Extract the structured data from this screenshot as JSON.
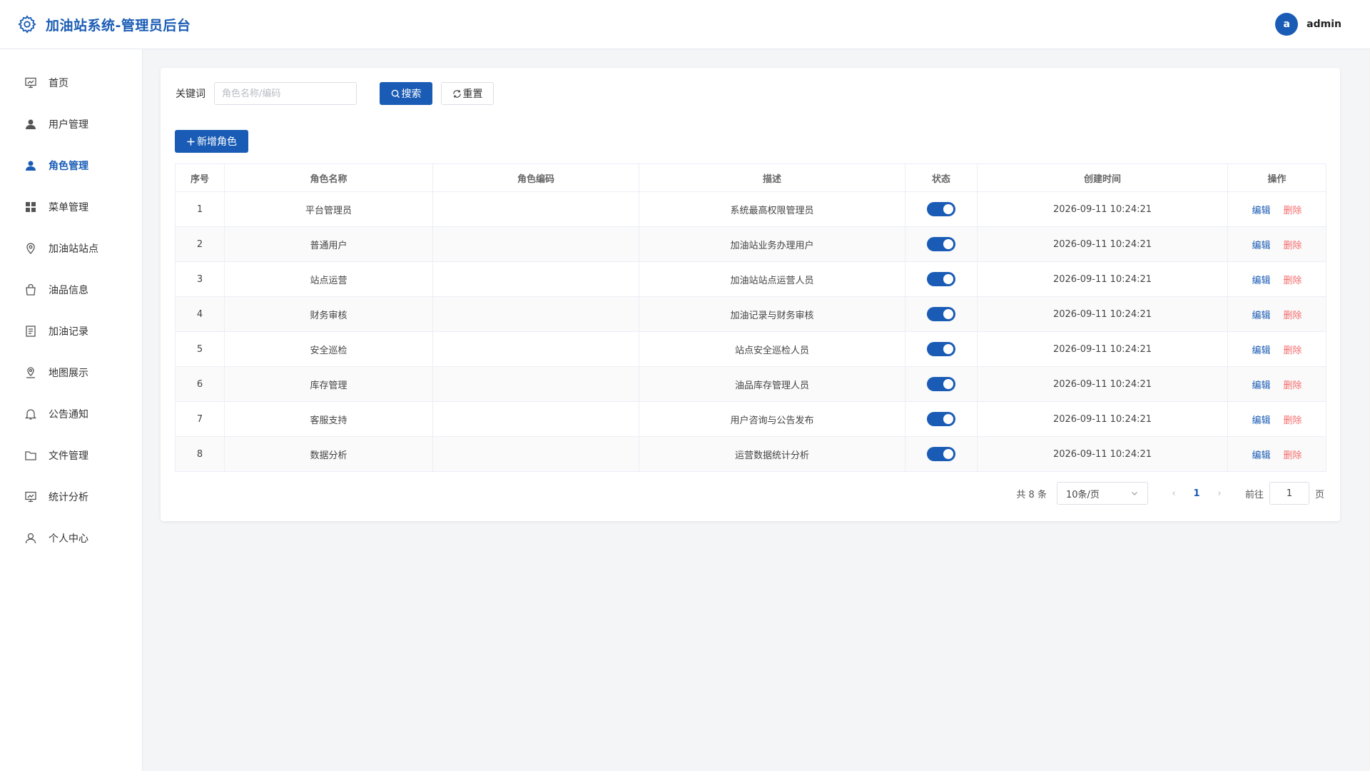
{
  "header": {
    "title": "加油站系统-管理员后台",
    "avatar_letter": "a",
    "username": "admin",
    "brand_color": "#1a5cb5"
  },
  "sidebar": {
    "items": [
      {
        "label": "首页",
        "icon": "dashboard-icon",
        "active": false
      },
      {
        "label": "用户管理",
        "icon": "user-icon",
        "active": false
      },
      {
        "label": "角色管理",
        "icon": "user-icon",
        "active": true
      },
      {
        "label": "菜单管理",
        "icon": "grid-icon",
        "active": false
      },
      {
        "label": "加油站站点",
        "icon": "location-icon",
        "active": false
      },
      {
        "label": "油品信息",
        "icon": "bag-icon",
        "active": false
      },
      {
        "label": "加油记录",
        "icon": "document-icon",
        "active": false
      },
      {
        "label": "地图展示",
        "icon": "map-pin-icon",
        "active": false
      },
      {
        "label": "公告通知",
        "icon": "bell-icon",
        "active": false
      },
      {
        "label": "文件管理",
        "icon": "folder-icon",
        "active": false
      },
      {
        "label": "统计分析",
        "icon": "chart-board-icon",
        "active": false
      },
      {
        "label": "个人中心",
        "icon": "person-outline-icon",
        "active": false
      }
    ]
  },
  "search": {
    "label": "关键词",
    "placeholder": "角色名称/编码",
    "value": "",
    "search_label": "搜索",
    "reset_label": "重置"
  },
  "add_label": "新增角色",
  "table": {
    "columns": [
      "序号",
      "角色名称",
      "角色编码",
      "描述",
      "状态",
      "创建时间",
      "操作"
    ],
    "edit_label": "编辑",
    "delete_label": "删除",
    "rows": [
      {
        "index": "1",
        "name": "平台管理员",
        "code": "",
        "desc": "系统最高权限管理员",
        "enabled": true,
        "created": "2026-09-11 10:24:21"
      },
      {
        "index": "2",
        "name": "普通用户",
        "code": "",
        "desc": "加油站业务办理用户",
        "enabled": true,
        "created": "2026-09-11 10:24:21"
      },
      {
        "index": "3",
        "name": "站点运营",
        "code": "",
        "desc": "加油站站点运营人员",
        "enabled": true,
        "created": "2026-09-11 10:24:21"
      },
      {
        "index": "4",
        "name": "财务审核",
        "code": "",
        "desc": "加油记录与财务审核",
        "enabled": true,
        "created": "2026-09-11 10:24:21"
      },
      {
        "index": "5",
        "name": "安全巡检",
        "code": "",
        "desc": "站点安全巡检人员",
        "enabled": true,
        "created": "2026-09-11 10:24:21"
      },
      {
        "index": "6",
        "name": "库存管理",
        "code": "",
        "desc": "油品库存管理人员",
        "enabled": true,
        "created": "2026-09-11 10:24:21"
      },
      {
        "index": "7",
        "name": "客服支持",
        "code": "",
        "desc": "用户咨询与公告发布",
        "enabled": true,
        "created": "2026-09-11 10:24:21"
      },
      {
        "index": "8",
        "name": "数据分析",
        "code": "",
        "desc": "运营数据统计分析",
        "enabled": true,
        "created": "2026-09-11 10:24:21"
      }
    ]
  },
  "pagination": {
    "total_text": "共 8 条",
    "page_size": "10条/页",
    "current_page": "1",
    "goto_label": "前往",
    "goto_value": "1",
    "page_suffix": "页"
  }
}
